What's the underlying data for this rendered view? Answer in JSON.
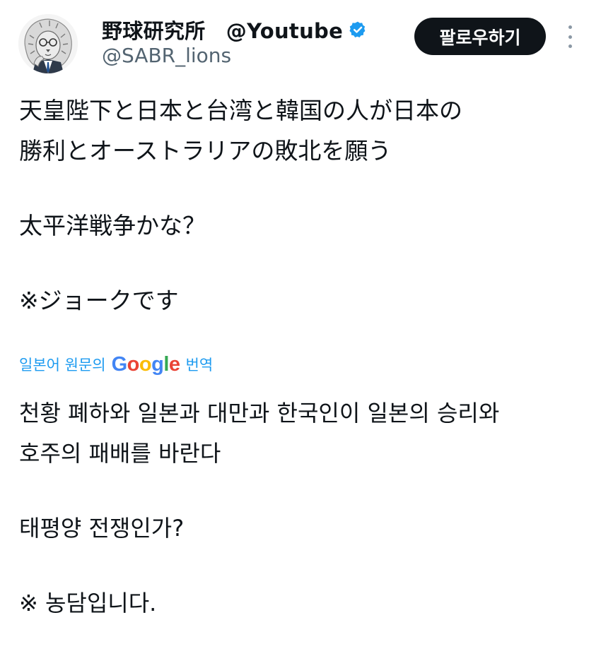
{
  "author": {
    "display_name": "野球研究所　@Youtube",
    "handle": "@SABR_lions",
    "verified": true,
    "avatar_icon": "lion-avatar-icon",
    "verified_icon": "verified-badge-icon"
  },
  "actions": {
    "follow_label": "팔로우하기",
    "more_icon": "more-vertical-icon"
  },
  "tweet": {
    "lines": [
      "天皇陛下と日本と台湾と韓国の人が日本の",
      "勝利とオーストラリアの敗北を願う",
      "",
      "太平洋戦争かな？",
      "",
      "※ジョークです"
    ]
  },
  "translation": {
    "prefix": "일본어 원문의",
    "provider": "Google",
    "suffix": "번역",
    "lines": [
      "천황 폐하와 일본과 대만과 한국인이 일본의 승리와",
      "호주의 패배를 바란다",
      "",
      "태평양 전쟁인가?",
      "",
      "※ 농담입니다."
    ]
  },
  "colors": {
    "accent": "#1d9bf0",
    "text": "#0f1419",
    "secondary": "#536471",
    "button_bg": "#0f1419",
    "button_text": "#ffffff"
  }
}
